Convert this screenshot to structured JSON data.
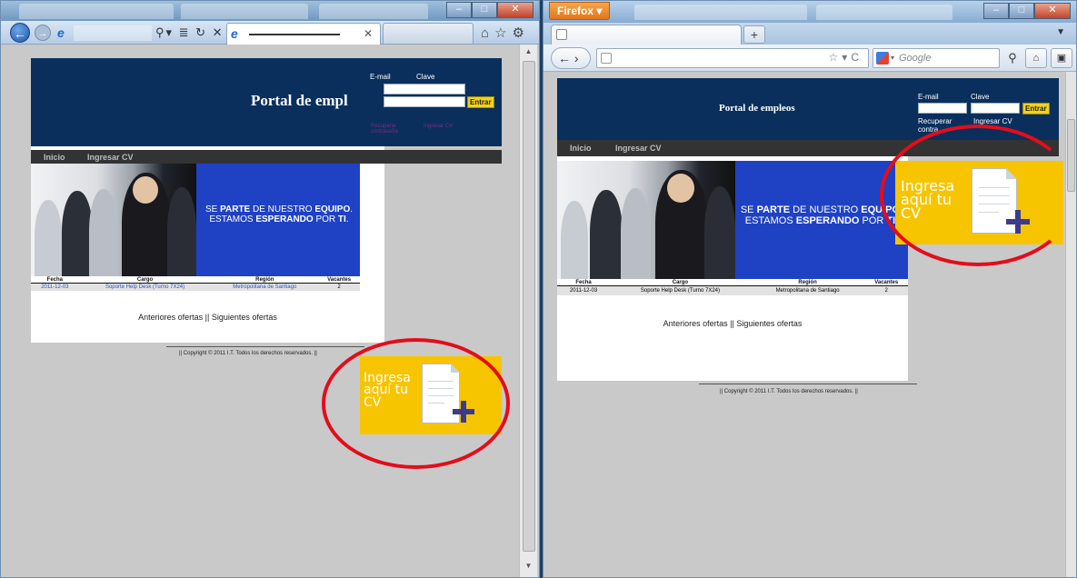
{
  "site": {
    "title_ie": "Portal de empl",
    "title_ff": "Portal de empleos",
    "email_label": "E-mail",
    "clave_label": "Clave",
    "entrar": "Entrar",
    "recuperar": "Recuperar contraseña",
    "recuperar_ff": "Recuperar contra",
    "ingresar_cv_link": "Ingresar CV",
    "menu": [
      "Inicio",
      "Ingresar CV"
    ],
    "banner": {
      "line1_a": "SE ",
      "line1_b": "PARTE",
      "line1_c": " DE NUESTRO ",
      "line1_d": "EQUIPO",
      "line1_e": ".",
      "line2_a": "ESTAMOS ",
      "line2_b": "ESPERANDO",
      "line2_c": " POR ",
      "line2_d": "TI",
      "line2_e": "."
    },
    "table": {
      "headers": [
        "Fecha",
        "Cargo",
        "Región",
        "Vacantes"
      ],
      "rows": [
        [
          "2011-12-03",
          "Soporte Help Desk (Turno 7X24)",
          "Metropolitana de Santiago",
          "2"
        ]
      ]
    },
    "pager": "Anteriores ofertas || Siguientes ofertas",
    "footer_ie": "|| Copyright © 2011        I.T. Todos los derechos reservados. ||",
    "footer_ff": "|| Copyright © 2011             I.T. Todos los derechos reservados. ||",
    "cv_promo": [
      "Ingresa",
      "aquí tu",
      "CV"
    ]
  },
  "firefox": {
    "menu_button": "Firefox",
    "search_placeholder": "Google"
  },
  "colors": {
    "header": "#0a2f5c",
    "menubar": "#333333",
    "cv_box": "#f7c400",
    "ring": "#e30d1b",
    "entrar": "#f2d21c"
  }
}
